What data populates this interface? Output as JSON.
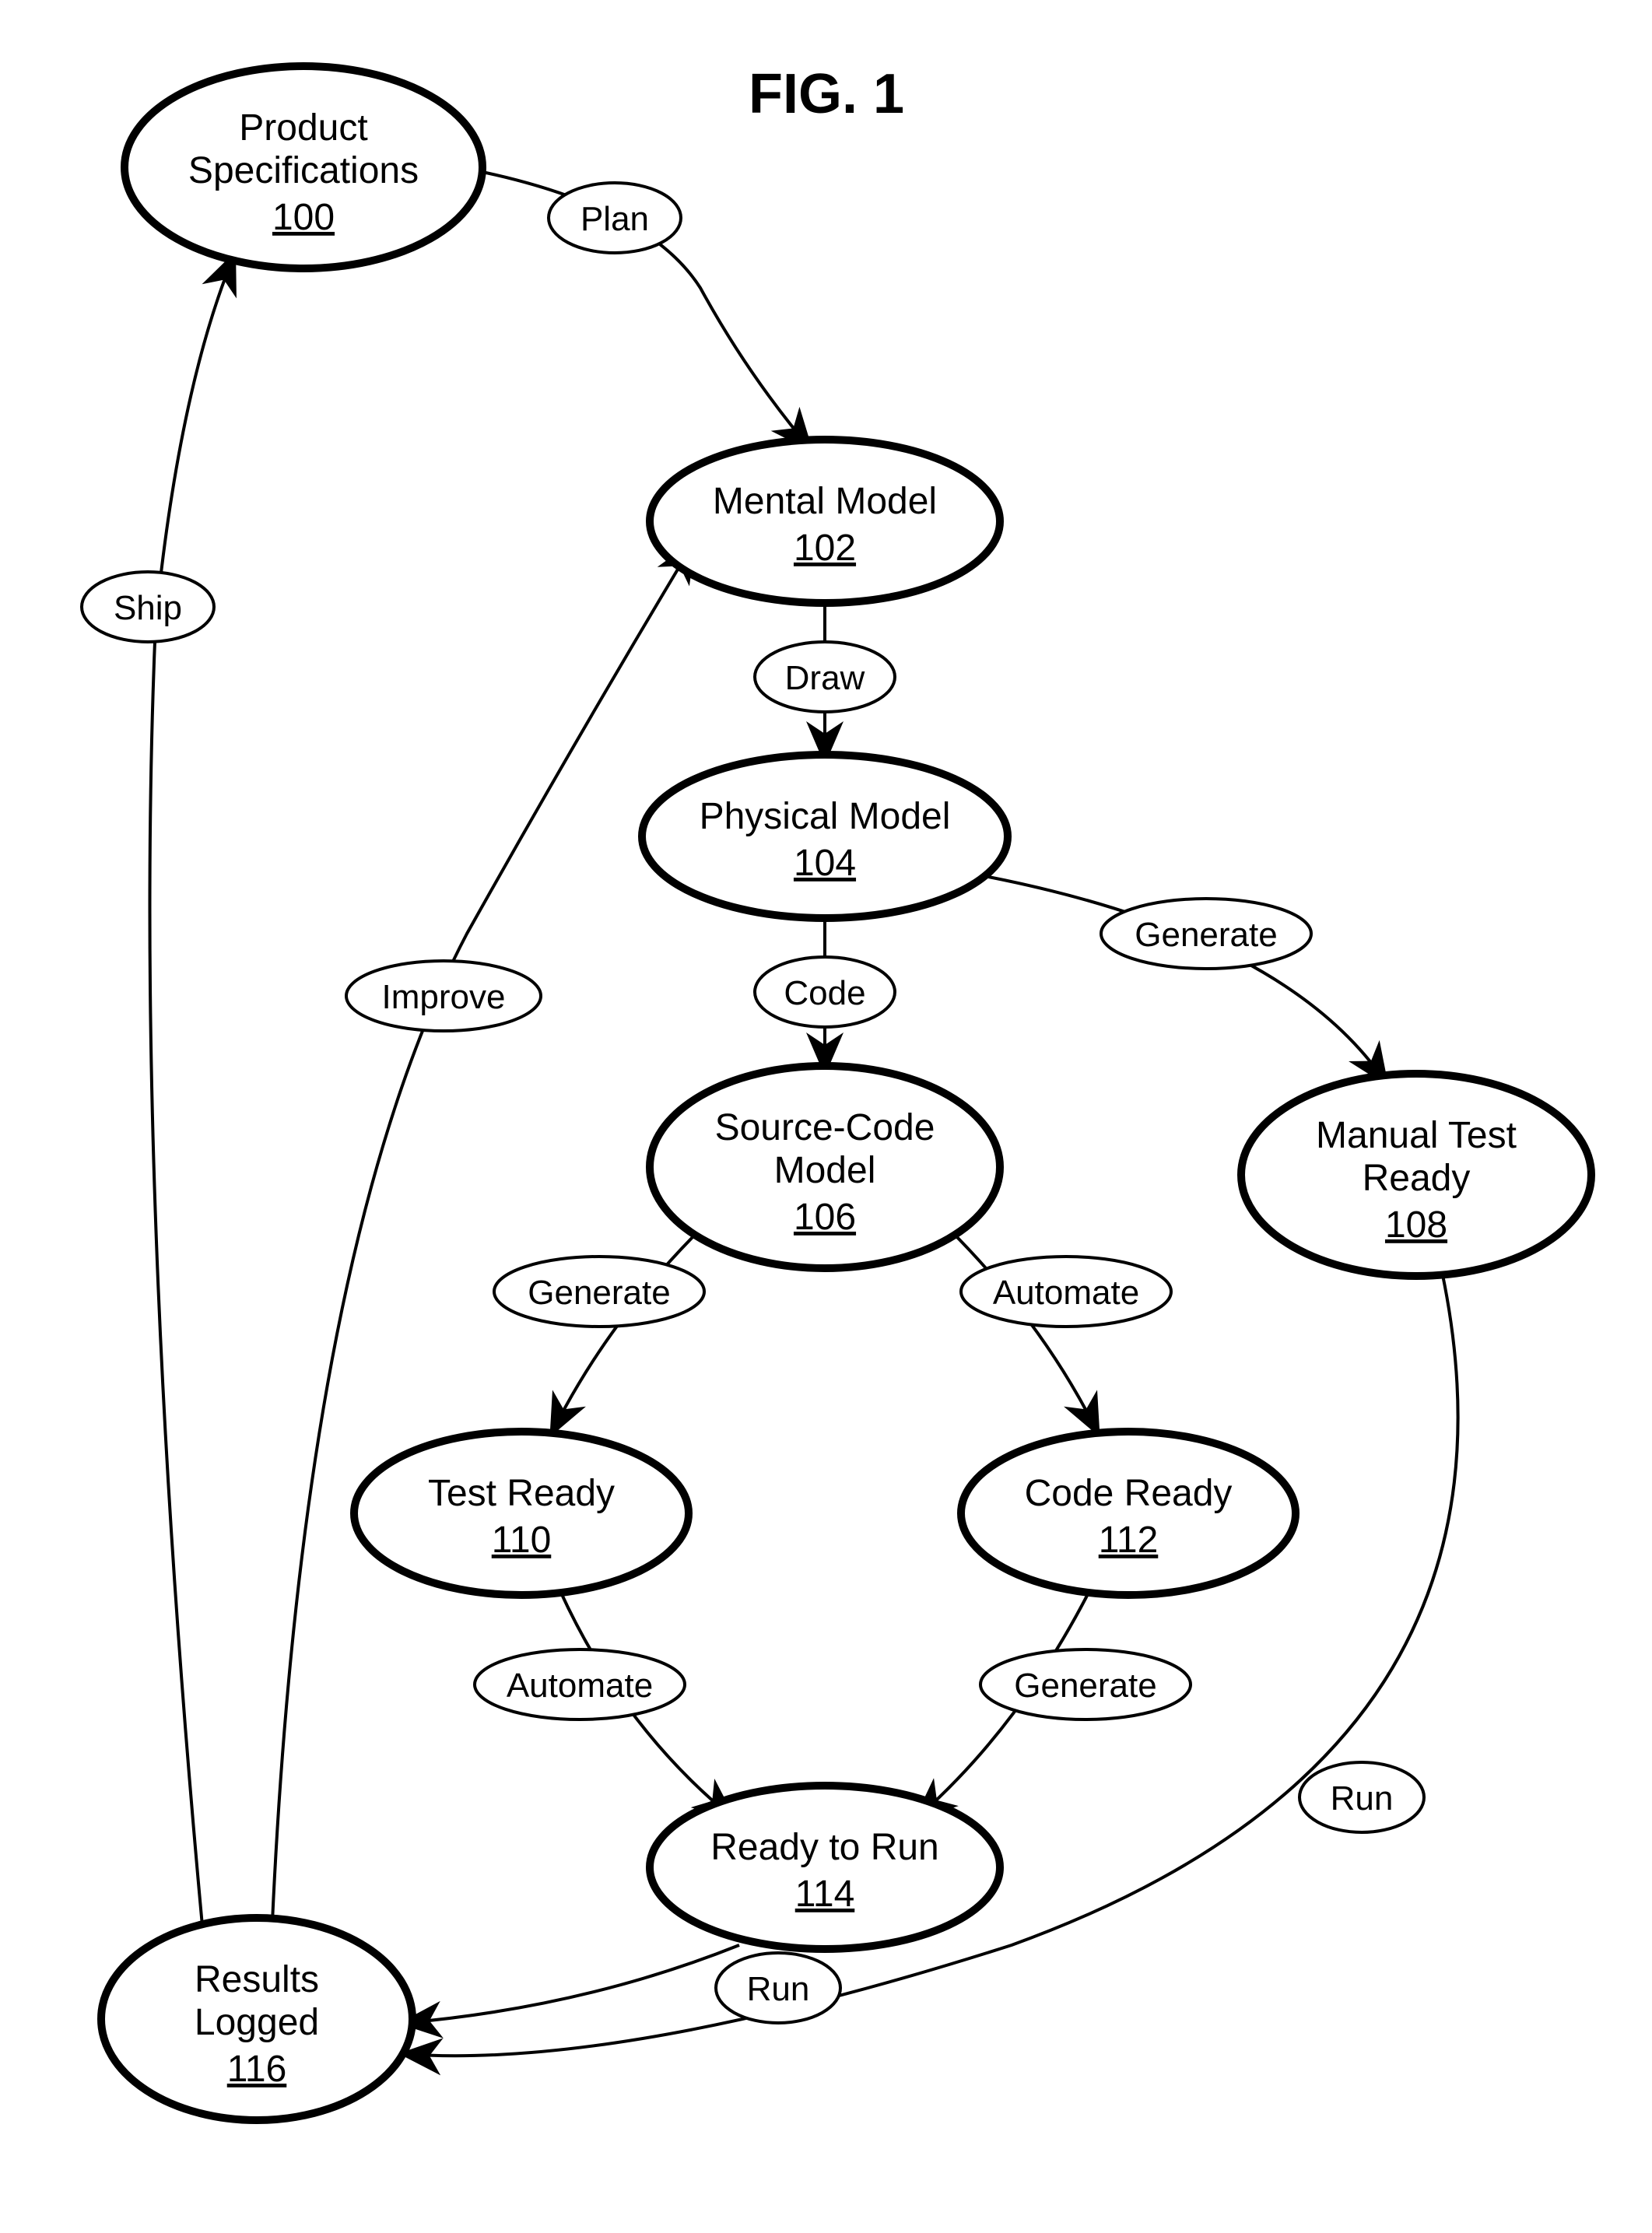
{
  "title": "FIG. 1",
  "nodes": {
    "n100": {
      "label1": "Product",
      "label2": "Specifications",
      "id": "100"
    },
    "n102": {
      "label1": "Mental Model",
      "id": "102"
    },
    "n104": {
      "label1": "Physical Model",
      "id": "104"
    },
    "n106": {
      "label1": "Source-Code",
      "label2": "Model",
      "id": "106"
    },
    "n108": {
      "label1": "Manual Test",
      "label2": "Ready",
      "id": "108"
    },
    "n110": {
      "label1": "Test Ready",
      "id": "110"
    },
    "n112": {
      "label1": "Code Ready",
      "id": "112"
    },
    "n114": {
      "label1": "Ready to Run",
      "id": "114"
    },
    "n116": {
      "label1": "Results",
      "label2": "Logged",
      "id": "116"
    }
  },
  "edges": {
    "plan": "Plan",
    "draw": "Draw",
    "code": "Code",
    "generate1": "Generate",
    "generate2": "Generate",
    "generate3": "Generate",
    "automate1": "Automate",
    "automate2": "Automate",
    "run1": "Run",
    "run2": "Run",
    "improve": "Improve",
    "ship": "Ship"
  }
}
